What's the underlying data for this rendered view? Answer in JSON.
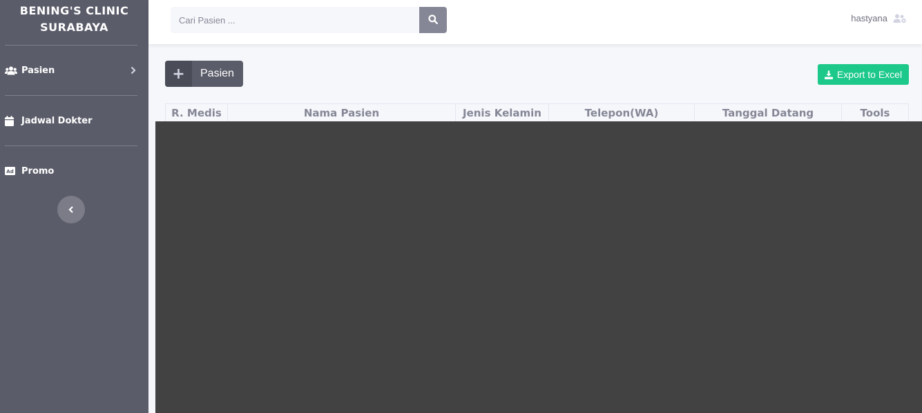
{
  "sidebar": {
    "brand_line1": "BENING'S CLINIC",
    "brand_line2": "SURABAYA",
    "items": [
      {
        "label": "Pasien",
        "icon": "users-icon"
      },
      {
        "label": "Jadwal Dokter",
        "icon": "calendar-icon"
      },
      {
        "label": "Promo",
        "icon": "ad-icon"
      }
    ],
    "toggle_icon": "chevron-left-icon"
  },
  "topbar": {
    "search_placeholder": "Cari Pasien ...",
    "username": "hastyana"
  },
  "toolbar": {
    "add_label": "Pasien",
    "export_label": "Export to Excel"
  },
  "table": {
    "columns": [
      "R. Medis",
      "Nama Pasien",
      "Jenis Kelamin",
      "Telepon(WA)",
      "Tanggal Datang",
      "Tools"
    ]
  },
  "colors": {
    "sidebar": "#5a5c69",
    "accent_success": "#1cc88a",
    "overlay": "#424242"
  }
}
